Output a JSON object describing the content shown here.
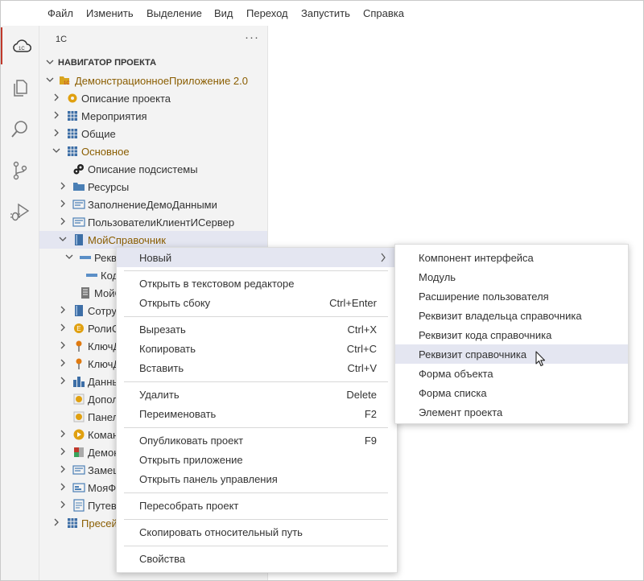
{
  "menubar": {
    "items": [
      "Файл",
      "Изменить",
      "Выделение",
      "Вид",
      "Переход",
      "Запустить",
      "Справка"
    ]
  },
  "sidebar": {
    "title": "1С",
    "more": "···",
    "tree": [
      {
        "label": "НАВИГАТОР ПРОЕКТА"
      },
      {
        "label": "ДемонстрационноеПриложение 2.0"
      },
      {
        "label": "Описание проекта"
      },
      {
        "label": "Мероприятия"
      },
      {
        "label": "Общие"
      },
      {
        "label": "Основное"
      },
      {
        "label": "Описание подсистемы"
      },
      {
        "label": "Ресурсы"
      },
      {
        "label": "ЗаполнениеДемоДанными"
      },
      {
        "label": "ПользователиКлиентИСервер"
      },
      {
        "label": "МойСправочник"
      },
      {
        "label": "Рекви"
      },
      {
        "label": "Код"
      },
      {
        "label": "МойС"
      },
      {
        "label": "Сотру"
      },
      {
        "label": "РолиС"
      },
      {
        "label": "КлючД"
      },
      {
        "label": "КлючД"
      },
      {
        "label": "Данны"
      },
      {
        "label": "Допол"
      },
      {
        "label": "Панел"
      },
      {
        "label": "Коман"
      },
      {
        "label": "Демон"
      },
      {
        "label": "Замещ"
      },
      {
        "label": "МояФ"
      },
      {
        "label": "Путев"
      },
      {
        "label": "Пресей"
      }
    ]
  },
  "context_menu": {
    "items": [
      {
        "label": "Новый",
        "shortcut": ""
      },
      {
        "label": "Открыть в текстовом редакторе",
        "shortcut": ""
      },
      {
        "label": "Открыть сбоку",
        "shortcut": "Ctrl+Enter"
      },
      {
        "label": "Вырезать",
        "shortcut": "Ctrl+X"
      },
      {
        "label": "Копировать",
        "shortcut": "Ctrl+C"
      },
      {
        "label": "Вставить",
        "shortcut": "Ctrl+V"
      },
      {
        "label": "Удалить",
        "shortcut": "Delete"
      },
      {
        "label": "Переименовать",
        "shortcut": "F2"
      },
      {
        "label": "Опубликовать проект",
        "shortcut": "F9"
      },
      {
        "label": "Открыть приложение",
        "shortcut": ""
      },
      {
        "label": "Открыть панель управления",
        "shortcut": ""
      },
      {
        "label": "Пересобрать проект",
        "shortcut": ""
      },
      {
        "label": "Скопировать относительный путь",
        "shortcut": ""
      },
      {
        "label": "Свойства",
        "shortcut": ""
      }
    ]
  },
  "submenu": {
    "items": [
      "Компонент интерфейса",
      "Модуль",
      "Расширение пользователя",
      "Реквизит владельца справочника",
      "Реквизит кода справочника",
      "Реквизит справочника",
      "Форма объекта",
      "Форма списка",
      "Элемент проекта"
    ],
    "highlighted": "Реквизит справочника"
  },
  "colors": {
    "folder_label": "#8a5d00",
    "accent": "#c0392b",
    "selection": "#e4e6f1"
  }
}
